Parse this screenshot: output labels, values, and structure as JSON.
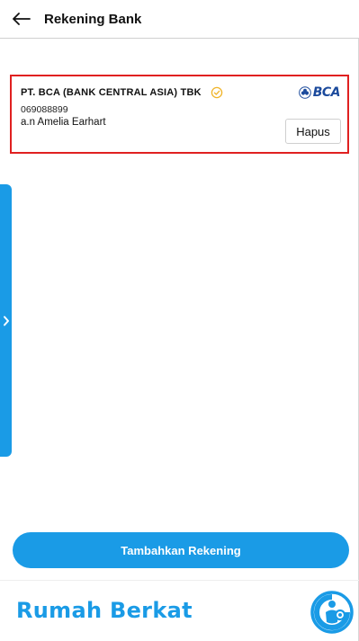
{
  "header": {
    "title": "Rekening Bank",
    "back_icon": "arrow-left-icon"
  },
  "account": {
    "bank_name": "PT. BCA (BANK CENTRAL ASIA) TBK",
    "account_number": "069088899",
    "holder": "a.n Amelia Earhart",
    "bank_logo_text": "BCA",
    "delete_label": "Hapus",
    "verified_icon": "check-circle-icon"
  },
  "actions": {
    "add_account_label": "Tambahkan Rekening"
  },
  "footer": {
    "brand": "Rumah Berkat"
  },
  "colors": {
    "accent": "#1a9be6",
    "highlight_border": "#e02020",
    "verified": "#f0b429",
    "bca_blue": "#1b4a9c"
  }
}
